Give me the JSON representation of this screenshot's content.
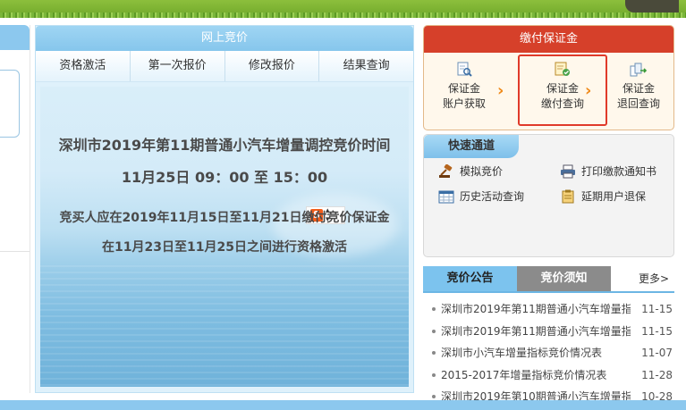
{
  "online_bidding": {
    "header": "网上竞价",
    "tabs": [
      "资格激活",
      "第一次报价",
      "修改报价",
      "结果查询"
    ]
  },
  "banner": {
    "title": "深圳市2019年第11期普通小汽车增量调控竞价时间",
    "time": "11月25日 09：00 至 15：00",
    "line1": "竞买人应在2019年11月15日至11月21日缴付竞价保证金",
    "line2": "在11月23日至11月25日之间进行资格激活",
    "ime_badge": "S"
  },
  "deposit": {
    "header": "缴付保证金",
    "items": [
      {
        "line1": "保证金",
        "line2": "账户获取",
        "icon": "search-doc-icon"
      },
      {
        "line1": "保证金",
        "line2": "缴付查询",
        "icon": "payment-doc-icon"
      },
      {
        "line1": "保证金",
        "line2": "退回查询",
        "icon": "refund-doc-icon"
      }
    ],
    "arrow": "›"
  },
  "quick_access": {
    "header": "快速通道",
    "items": [
      {
        "label": "模拟竞价",
        "icon": "gavel-icon"
      },
      {
        "label": "打印缴款通知书",
        "icon": "printer-icon"
      },
      {
        "label": "历史活动查询",
        "icon": "calendar-icon"
      },
      {
        "label": "延期用户退保",
        "icon": "clipboard-icon"
      }
    ]
  },
  "notice": {
    "tab_active": "竞价公告",
    "tab_inactive": "竞价须知",
    "more": "更多>",
    "rows": [
      {
        "title": "深圳市2019年第11期普通小汽车增量指",
        "date": "11-15"
      },
      {
        "title": "深圳市2019年第11期普通小汽车增量指",
        "date": "11-15"
      },
      {
        "title": "深圳市小汽车增量指标竞价情况表",
        "date": "11-07"
      },
      {
        "title": "2015-2017年增量指标竞价情况表",
        "date": "11-28"
      },
      {
        "title": "深圳市2019年第10期普通小汽车增量指",
        "date": "10-28"
      }
    ]
  },
  "colors": {
    "deposit_header": "#d6402a",
    "selected_border": "#e03a2a",
    "arrow": "#f08a1a",
    "tab_active": "#7cc3ee",
    "tab_inactive": "#8b8b8b"
  }
}
